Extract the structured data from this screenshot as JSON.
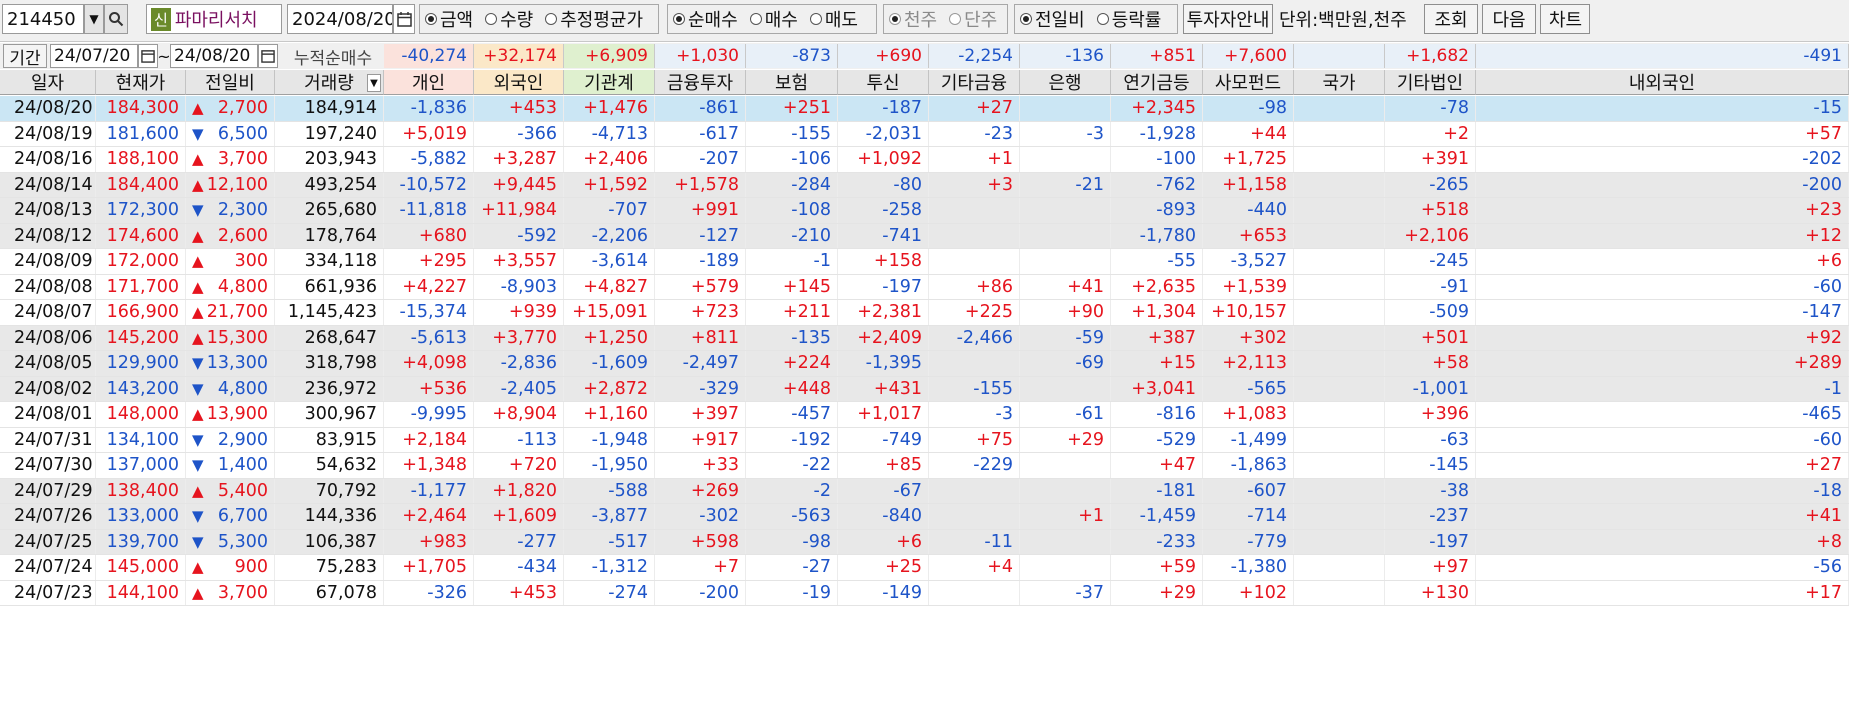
{
  "toolbar": {
    "stock_code": "214450",
    "new_badge": "신",
    "stock_name": "파마리서치",
    "date": "2024/08/20",
    "metric_options": [
      "금액",
      "수량",
      "추정평균가"
    ],
    "metric_selected": 0,
    "trade_options": [
      "순매수",
      "매수",
      "매도"
    ],
    "trade_selected": 0,
    "scale_options": [
      "천주",
      "단주"
    ],
    "scale_selected": 0,
    "compare_options": [
      "전일비",
      "등락률"
    ],
    "compare_selected": 0,
    "investor_guide_label": "투자자안내",
    "unit_label": "단위:백만원,천주",
    "query_label": "조회",
    "next_label": "다음",
    "chart_label": "차트"
  },
  "period": {
    "label": "기간",
    "from": "24/07/20",
    "tilde": "~",
    "to": "24/08/20",
    "cumulative_label": "누적순매수",
    "sums": [
      "-40,274",
      "+32,174",
      "+6,909",
      "+1,030",
      "-873",
      "+690",
      "-2,254",
      "-136",
      "+851",
      "+7,600",
      "",
      "+1,682",
      "-491"
    ]
  },
  "columns": [
    "일자",
    "현재가",
    "전일비",
    "거래량",
    "개인",
    "외국인",
    "기관계",
    "금융투자",
    "보험",
    "투신",
    "기타금융",
    "은행",
    "연기금등",
    "사모펀드",
    "국가",
    "기타법인",
    "내외국인"
  ],
  "rows": [
    {
      "date": "24/08/20",
      "price": "184,300",
      "dir": "up",
      "chg": "2,700",
      "vol": "184,914",
      "v": [
        "-1,836",
        "+453",
        "+1,476",
        "-861",
        "+251",
        "-187",
        "+27",
        "",
        "+2,345",
        "-98",
        "",
        "-78",
        "-15"
      ],
      "shade": "sel"
    },
    {
      "date": "24/08/19",
      "price": "181,600",
      "dir": "down",
      "chg": "6,500",
      "vol": "197,240",
      "v": [
        "+5,019",
        "-366",
        "-4,713",
        "-617",
        "-155",
        "-2,031",
        "-23",
        "-3",
        "-1,928",
        "+44",
        "",
        "+2",
        "+57"
      ],
      "shade": "w"
    },
    {
      "date": "24/08/16",
      "price": "188,100",
      "dir": "up",
      "chg": "3,700",
      "vol": "203,943",
      "v": [
        "-5,882",
        "+3,287",
        "+2,406",
        "-207",
        "-106",
        "+1,092",
        "+1",
        "",
        "-100",
        "+1,725",
        "",
        "+391",
        "-202"
      ],
      "shade": "w"
    },
    {
      "date": "24/08/14",
      "price": "184,400",
      "dir": "up",
      "chg": "12,100",
      "vol": "493,254",
      "v": [
        "-10,572",
        "+9,445",
        "+1,592",
        "+1,578",
        "-284",
        "-80",
        "+3",
        "-21",
        "-762",
        "+1,158",
        "",
        "-265",
        "-200"
      ],
      "shade": "g"
    },
    {
      "date": "24/08/13",
      "price": "172,300",
      "dir": "down",
      "chg": "2,300",
      "vol": "265,680",
      "v": [
        "-11,818",
        "+11,984",
        "-707",
        "+991",
        "-108",
        "-258",
        "",
        "",
        "-893",
        "-440",
        "",
        "+518",
        "+23"
      ],
      "shade": "g"
    },
    {
      "date": "24/08/12",
      "price": "174,600",
      "dir": "up",
      "chg": "2,600",
      "vol": "178,764",
      "v": [
        "+680",
        "-592",
        "-2,206",
        "-127",
        "-210",
        "-741",
        "",
        "",
        "-1,780",
        "+653",
        "",
        "+2,106",
        "+12"
      ],
      "shade": "g"
    },
    {
      "date": "24/08/09",
      "price": "172,000",
      "dir": "up",
      "chg": "300",
      "vol": "334,118",
      "v": [
        "+295",
        "+3,557",
        "-3,614",
        "-189",
        "-1",
        "+158",
        "",
        "",
        "-55",
        "-3,527",
        "",
        "-245",
        "+6"
      ],
      "shade": "w"
    },
    {
      "date": "24/08/08",
      "price": "171,700",
      "dir": "up",
      "chg": "4,800",
      "vol": "661,936",
      "v": [
        "+4,227",
        "-8,903",
        "+4,827",
        "+579",
        "+145",
        "-197",
        "+86",
        "+41",
        "+2,635",
        "+1,539",
        "",
        "-91",
        "-60"
      ],
      "shade": "w"
    },
    {
      "date": "24/08/07",
      "price": "166,900",
      "dir": "up",
      "chg": "21,700",
      "vol": "1,145,423",
      "v": [
        "-15,374",
        "+939",
        "+15,091",
        "+723",
        "+211",
        "+2,381",
        "+225",
        "+90",
        "+1,304",
        "+10,157",
        "",
        "-509",
        "-147"
      ],
      "shade": "w"
    },
    {
      "date": "24/08/06",
      "price": "145,200",
      "dir": "up",
      "chg": "15,300",
      "vol": "268,647",
      "v": [
        "-5,613",
        "+3,770",
        "+1,250",
        "+811",
        "-135",
        "+2,409",
        "-2,466",
        "-59",
        "+387",
        "+302",
        "",
        "+501",
        "+92"
      ],
      "shade": "g"
    },
    {
      "date": "24/08/05",
      "price": "129,900",
      "dir": "down",
      "chg": "13,300",
      "vol": "318,798",
      "v": [
        "+4,098",
        "-2,836",
        "-1,609",
        "-2,497",
        "+224",
        "-1,395",
        "",
        "-69",
        "+15",
        "+2,113",
        "",
        "+58",
        "+289"
      ],
      "shade": "g"
    },
    {
      "date": "24/08/02",
      "price": "143,200",
      "dir": "down",
      "chg": "4,800",
      "vol": "236,972",
      "v": [
        "+536",
        "-2,405",
        "+2,872",
        "-329",
        "+448",
        "+431",
        "-155",
        "",
        "+3,041",
        "-565",
        "",
        "-1,001",
        "-1"
      ],
      "shade": "g"
    },
    {
      "date": "24/08/01",
      "price": "148,000",
      "dir": "up",
      "chg": "13,900",
      "vol": "300,967",
      "v": [
        "-9,995",
        "+8,904",
        "+1,160",
        "+397",
        "-457",
        "+1,017",
        "-3",
        "-61",
        "-816",
        "+1,083",
        "",
        "+396",
        "-465"
      ],
      "shade": "w"
    },
    {
      "date": "24/07/31",
      "price": "134,100",
      "dir": "down",
      "chg": "2,900",
      "vol": "83,915",
      "v": [
        "+2,184",
        "-113",
        "-1,948",
        "+917",
        "-192",
        "-749",
        "+75",
        "+29",
        "-529",
        "-1,499",
        "",
        "-63",
        "-60"
      ],
      "shade": "w"
    },
    {
      "date": "24/07/30",
      "price": "137,000",
      "dir": "down",
      "chg": "1,400",
      "vol": "54,632",
      "v": [
        "+1,348",
        "+720",
        "-1,950",
        "+33",
        "-22",
        "+85",
        "-229",
        "",
        "+47",
        "-1,863",
        "",
        "-145",
        "+27"
      ],
      "shade": "w"
    },
    {
      "date": "24/07/29",
      "price": "138,400",
      "dir": "up",
      "chg": "5,400",
      "vol": "70,792",
      "v": [
        "-1,177",
        "+1,820",
        "-588",
        "+269",
        "-2",
        "-67",
        "",
        "",
        "-181",
        "-607",
        "",
        "-38",
        "-18"
      ],
      "shade": "g"
    },
    {
      "date": "24/07/26",
      "price": "133,000",
      "dir": "down",
      "chg": "6,700",
      "vol": "144,336",
      "v": [
        "+2,464",
        "+1,609",
        "-3,877",
        "-302",
        "-563",
        "-840",
        "",
        "+1",
        "-1,459",
        "-714",
        "",
        "-237",
        "+41"
      ],
      "shade": "g"
    },
    {
      "date": "24/07/25",
      "price": "139,700",
      "dir": "down",
      "chg": "5,300",
      "vol": "106,387",
      "v": [
        "+983",
        "-277",
        "-517",
        "+598",
        "-98",
        "+6",
        "-11",
        "",
        "-233",
        "-779",
        "",
        "-197",
        "+8"
      ],
      "shade": "g"
    },
    {
      "date": "24/07/24",
      "price": "145,000",
      "dir": "up",
      "chg": "900",
      "vol": "75,283",
      "v": [
        "+1,705",
        "-434",
        "-1,312",
        "+7",
        "-27",
        "+25",
        "+4",
        "",
        "+59",
        "-1,380",
        "",
        "+97",
        "-56"
      ],
      "shade": "w"
    },
    {
      "date": "24/07/23",
      "price": "144,100",
      "dir": "up",
      "chg": "3,700",
      "vol": "67,078",
      "v": [
        "-326",
        "+453",
        "-274",
        "-200",
        "-19",
        "-149",
        "",
        "-37",
        "+29",
        "+102",
        "",
        "+130",
        "+17"
      ],
      "shade": "w"
    }
  ],
  "colors": {
    "up": "#e6141e",
    "down": "#1e54c8",
    "selected_row": "#cbe6f4",
    "gray_row": "#e8e8e8",
    "individual_hdr": "#fbe2dc",
    "foreign_hdr": "#fbe8c8",
    "institution_hdr": "#dff0cf"
  },
  "icons": {
    "dropdown": "chevron-down-icon",
    "search": "search-icon",
    "calendar": "calendar-icon",
    "sort": "sort-down-icon",
    "up": "triangle-up-icon",
    "down": "triangle-down-icon"
  }
}
